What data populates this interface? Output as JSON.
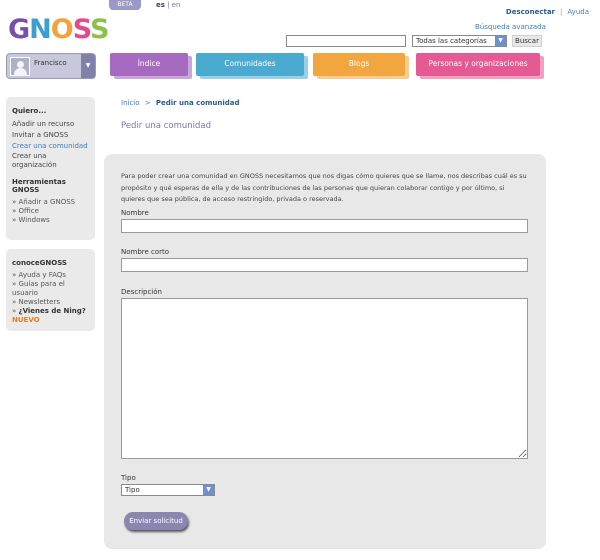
{
  "logo": {
    "letters": [
      "G",
      "N",
      "O",
      "S",
      "S"
    ],
    "colors": [
      "#7a4fa8",
      "#3d9fcf",
      "#f2a33a",
      "#e24b8c",
      "#8cc04b"
    ]
  },
  "beta_label": "BETA",
  "lang": {
    "es": "es",
    "sep": "|",
    "en": "en"
  },
  "topbar": {
    "logout": "Desconectar",
    "sep": "|",
    "help": "Ayuda",
    "advanced_search": "Búsqueda avanzada"
  },
  "search": {
    "value": "",
    "category_selected": "Todas las categorías",
    "button": "Buscar"
  },
  "user": {
    "name": "Francisco"
  },
  "nav": {
    "tabs": [
      {
        "label": "Índice",
        "color": "#a66ac0"
      },
      {
        "label": "Comunidades",
        "color": "#4aaad0"
      },
      {
        "label": "Blogs",
        "color": "#f2a640"
      },
      {
        "label": "Personas y organizaciones",
        "color": "#e65a94"
      }
    ]
  },
  "sidebar": {
    "quiero_title": "Quiero...",
    "quiero_items": [
      "Añadir un recurso",
      "Invitar a GNOSS",
      "Crear una comunidad",
      "Crear una organización"
    ],
    "tools_title": "Herramientas GNOSS",
    "tools_items": [
      "Añadir a GNOSS",
      "Office",
      "Windows"
    ],
    "conoce_title": "conoceGNOSS",
    "conoce_items": [
      "Ayuda y FAQs",
      "Guías para el usuario",
      "Newsletters"
    ],
    "ning_label": "¿Vienes de Ning?",
    "nuevo_label": "NUEVO"
  },
  "breadcrumb": {
    "home": "Inicio",
    "sep": ">",
    "current": "Pedir una comunidad"
  },
  "page_title": "Pedir una comunidad",
  "form": {
    "intro": "Para poder crear una comunidad en GNOSS necesitamos que nos digas cómo quieres que se llame, nos describas cuál es su propósito y qué esperas de ella y de las contribuciones de las personas que quieran colaborar contigo y por último, si quieres que sea pública, de acceso restringido, privada o reservada.",
    "nombre_label": "Nombre",
    "nombre_corto_label": "Nombre corto",
    "descripcion_label": "Descripción",
    "tipo_label": "Tipo",
    "tipo_selected": "Tipo",
    "submit_label": "Enviar solicitud"
  }
}
